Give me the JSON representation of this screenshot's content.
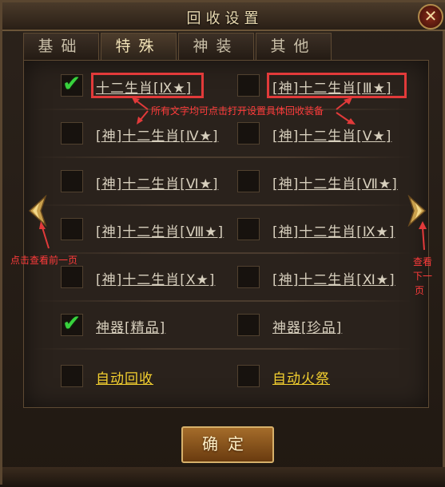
{
  "window": {
    "title": "回收设置",
    "close_glyph": "✕"
  },
  "tabs": [
    {
      "label": "基础",
      "active": false
    },
    {
      "label": "特殊",
      "active": true
    },
    {
      "label": "神装",
      "active": false
    },
    {
      "label": "其他",
      "active": false
    }
  ],
  "items": {
    "r1_left": {
      "label": "十二生肖[Ⅸ★]",
      "checked": true
    },
    "r1_right": {
      "label": "[神]十二生肖[Ⅲ★]",
      "checked": false
    },
    "r2_left": {
      "label": "[神]十二生肖[Ⅳ★]",
      "checked": false
    },
    "r2_right": {
      "label": "[神]十二生肖[Ⅴ★]",
      "checked": false
    },
    "r3_left": {
      "label": "[神]十二生肖[Ⅵ★]",
      "checked": false
    },
    "r3_right": {
      "label": "[神]十二生肖[Ⅶ★]",
      "checked": false
    },
    "r4_left": {
      "label": "[神]十二生肖[Ⅷ★]",
      "checked": false
    },
    "r4_right": {
      "label": "[神]十二生肖[Ⅸ★]",
      "checked": false
    },
    "r5_left": {
      "label": "[神]十二生肖[Ⅹ★]",
      "checked": false
    },
    "r5_right": {
      "label": "[神]十二生肖[Ⅺ★]",
      "checked": false
    },
    "r6_left": {
      "label": "神器[精品]",
      "checked": true
    },
    "r6_right": {
      "label": "神器[珍品]",
      "checked": false
    },
    "r7_left": {
      "label": "自动回收",
      "checked": false
    },
    "r7_right": {
      "label": "自动火祭",
      "checked": false
    }
  },
  "annotations": {
    "center_note": "所有文字均可点击打开设置具体回收装备",
    "left_note": "点击查看前一页",
    "right_note_line1": "查看",
    "right_note_line2": "下一",
    "right_note_line3": "页"
  },
  "footer": {
    "confirm_label": "确定"
  },
  "colors": {
    "check_green": "#38d23d",
    "label_yellow": "#f2cf2f",
    "annotation_red": "#e23a3a"
  },
  "icons": {
    "prev": "chevron-left-icon",
    "next": "chevron-right-icon",
    "check": "checkmark-icon"
  }
}
